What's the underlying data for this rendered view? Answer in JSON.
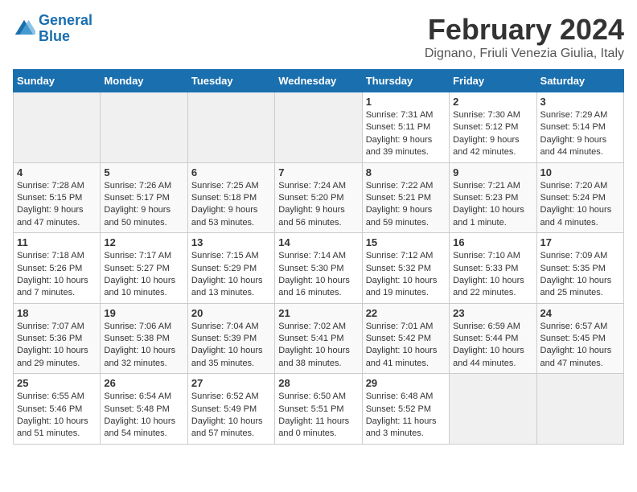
{
  "logo": {
    "text_general": "General",
    "text_blue": "Blue"
  },
  "header": {
    "title": "February 2024",
    "subtitle": "Dignano, Friuli Venezia Giulia, Italy"
  },
  "days_of_week": [
    "Sunday",
    "Monday",
    "Tuesday",
    "Wednesday",
    "Thursday",
    "Friday",
    "Saturday"
  ],
  "weeks": [
    [
      {
        "day": "",
        "info": ""
      },
      {
        "day": "",
        "info": ""
      },
      {
        "day": "",
        "info": ""
      },
      {
        "day": "",
        "info": ""
      },
      {
        "day": "1",
        "info": "Sunrise: 7:31 AM\nSunset: 5:11 PM\nDaylight: 9 hours and 39 minutes."
      },
      {
        "day": "2",
        "info": "Sunrise: 7:30 AM\nSunset: 5:12 PM\nDaylight: 9 hours and 42 minutes."
      },
      {
        "day": "3",
        "info": "Sunrise: 7:29 AM\nSunset: 5:14 PM\nDaylight: 9 hours and 44 minutes."
      }
    ],
    [
      {
        "day": "4",
        "info": "Sunrise: 7:28 AM\nSunset: 5:15 PM\nDaylight: 9 hours and 47 minutes."
      },
      {
        "day": "5",
        "info": "Sunrise: 7:26 AM\nSunset: 5:17 PM\nDaylight: 9 hours and 50 minutes."
      },
      {
        "day": "6",
        "info": "Sunrise: 7:25 AM\nSunset: 5:18 PM\nDaylight: 9 hours and 53 minutes."
      },
      {
        "day": "7",
        "info": "Sunrise: 7:24 AM\nSunset: 5:20 PM\nDaylight: 9 hours and 56 minutes."
      },
      {
        "day": "8",
        "info": "Sunrise: 7:22 AM\nSunset: 5:21 PM\nDaylight: 9 hours and 59 minutes."
      },
      {
        "day": "9",
        "info": "Sunrise: 7:21 AM\nSunset: 5:23 PM\nDaylight: 10 hours and 1 minute."
      },
      {
        "day": "10",
        "info": "Sunrise: 7:20 AM\nSunset: 5:24 PM\nDaylight: 10 hours and 4 minutes."
      }
    ],
    [
      {
        "day": "11",
        "info": "Sunrise: 7:18 AM\nSunset: 5:26 PM\nDaylight: 10 hours and 7 minutes."
      },
      {
        "day": "12",
        "info": "Sunrise: 7:17 AM\nSunset: 5:27 PM\nDaylight: 10 hours and 10 minutes."
      },
      {
        "day": "13",
        "info": "Sunrise: 7:15 AM\nSunset: 5:29 PM\nDaylight: 10 hours and 13 minutes."
      },
      {
        "day": "14",
        "info": "Sunrise: 7:14 AM\nSunset: 5:30 PM\nDaylight: 10 hours and 16 minutes."
      },
      {
        "day": "15",
        "info": "Sunrise: 7:12 AM\nSunset: 5:32 PM\nDaylight: 10 hours and 19 minutes."
      },
      {
        "day": "16",
        "info": "Sunrise: 7:10 AM\nSunset: 5:33 PM\nDaylight: 10 hours and 22 minutes."
      },
      {
        "day": "17",
        "info": "Sunrise: 7:09 AM\nSunset: 5:35 PM\nDaylight: 10 hours and 25 minutes."
      }
    ],
    [
      {
        "day": "18",
        "info": "Sunrise: 7:07 AM\nSunset: 5:36 PM\nDaylight: 10 hours and 29 minutes."
      },
      {
        "day": "19",
        "info": "Sunrise: 7:06 AM\nSunset: 5:38 PM\nDaylight: 10 hours and 32 minutes."
      },
      {
        "day": "20",
        "info": "Sunrise: 7:04 AM\nSunset: 5:39 PM\nDaylight: 10 hours and 35 minutes."
      },
      {
        "day": "21",
        "info": "Sunrise: 7:02 AM\nSunset: 5:41 PM\nDaylight: 10 hours and 38 minutes."
      },
      {
        "day": "22",
        "info": "Sunrise: 7:01 AM\nSunset: 5:42 PM\nDaylight: 10 hours and 41 minutes."
      },
      {
        "day": "23",
        "info": "Sunrise: 6:59 AM\nSunset: 5:44 PM\nDaylight: 10 hours and 44 minutes."
      },
      {
        "day": "24",
        "info": "Sunrise: 6:57 AM\nSunset: 5:45 PM\nDaylight: 10 hours and 47 minutes."
      }
    ],
    [
      {
        "day": "25",
        "info": "Sunrise: 6:55 AM\nSunset: 5:46 PM\nDaylight: 10 hours and 51 minutes."
      },
      {
        "day": "26",
        "info": "Sunrise: 6:54 AM\nSunset: 5:48 PM\nDaylight: 10 hours and 54 minutes."
      },
      {
        "day": "27",
        "info": "Sunrise: 6:52 AM\nSunset: 5:49 PM\nDaylight: 10 hours and 57 minutes."
      },
      {
        "day": "28",
        "info": "Sunrise: 6:50 AM\nSunset: 5:51 PM\nDaylight: 11 hours and 0 minutes."
      },
      {
        "day": "29",
        "info": "Sunrise: 6:48 AM\nSunset: 5:52 PM\nDaylight: 11 hours and 3 minutes."
      },
      {
        "day": "",
        "info": ""
      },
      {
        "day": "",
        "info": ""
      }
    ]
  ]
}
